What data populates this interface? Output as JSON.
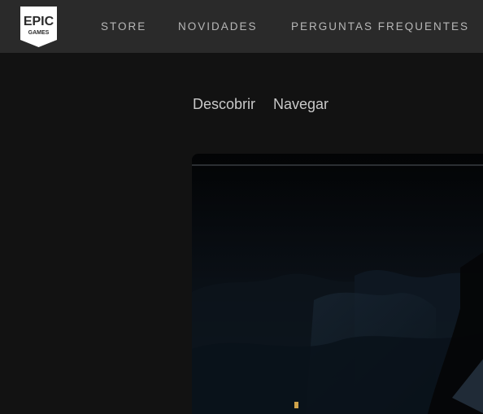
{
  "header": {
    "logo": {
      "line1": "EPIC",
      "line2": "GAMES",
      "icon": "epic-games-logo"
    },
    "nav": [
      {
        "label": "STORE"
      },
      {
        "label": "NOVIDADES"
      },
      {
        "label": "PERGUNTAS FREQUENTES"
      }
    ]
  },
  "subnav": {
    "discover": "Descobrir",
    "browse": "Navegar"
  },
  "hero": {
    "icon": "featured-game-banner"
  },
  "colors": {
    "topbar": "#2a2a2a",
    "background": "#121212",
    "nav_text": "#b7b7b7"
  }
}
